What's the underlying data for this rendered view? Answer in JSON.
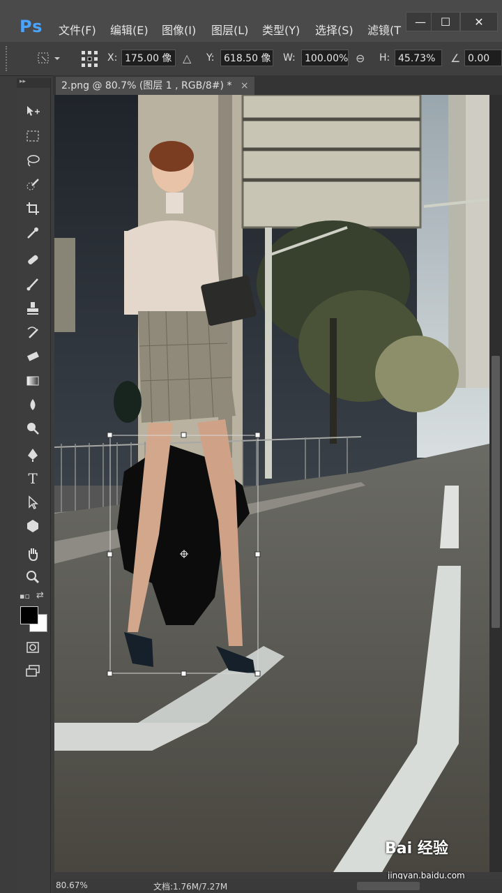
{
  "app": {
    "logo": "Ps"
  },
  "menu": [
    "文件(F)",
    "编辑(E)",
    "图像(I)",
    "图层(L)",
    "类型(Y)",
    "选择(S)",
    "滤镜(T"
  ],
  "window_buttons": [
    "—",
    "☐",
    "✕"
  ],
  "options": {
    "x_label": "X:",
    "x_value": "175.00 像",
    "y_label": "Y:",
    "y_value": "618.50 像",
    "w_label": "W:",
    "w_value": "100.00%",
    "h_label": "H:",
    "h_value": "45.73%",
    "angle_value": "0.00"
  },
  "document_tab": {
    "title": "2.png @ 80.7% (图层 1 , RGB/8#) *",
    "close": "×"
  },
  "tools": [
    "move-tool",
    "marquee-tool",
    "lasso-tool",
    "quick-selection-tool",
    "crop-tool",
    "eyedropper-tool",
    "healing-brush-tool",
    "brush-tool",
    "clone-stamp-tool",
    "history-brush-tool",
    "eraser-tool",
    "gradient-tool",
    "blur-tool",
    "dodge-tool",
    "pen-tool",
    "type-tool",
    "path-selection-tool",
    "shape-tool",
    "hand-tool",
    "zoom-tool"
  ],
  "type_tool_glyph": "T",
  "status": {
    "zoom": "80.67%",
    "doc": "文档:1.76M/7.27M"
  },
  "watermark": {
    "brand": "Bai  经验",
    "url": "jingyan.baidu.com"
  },
  "colors": {
    "foreground": "#000000",
    "background": "#ffffff",
    "accent": "#4aa3ff"
  }
}
